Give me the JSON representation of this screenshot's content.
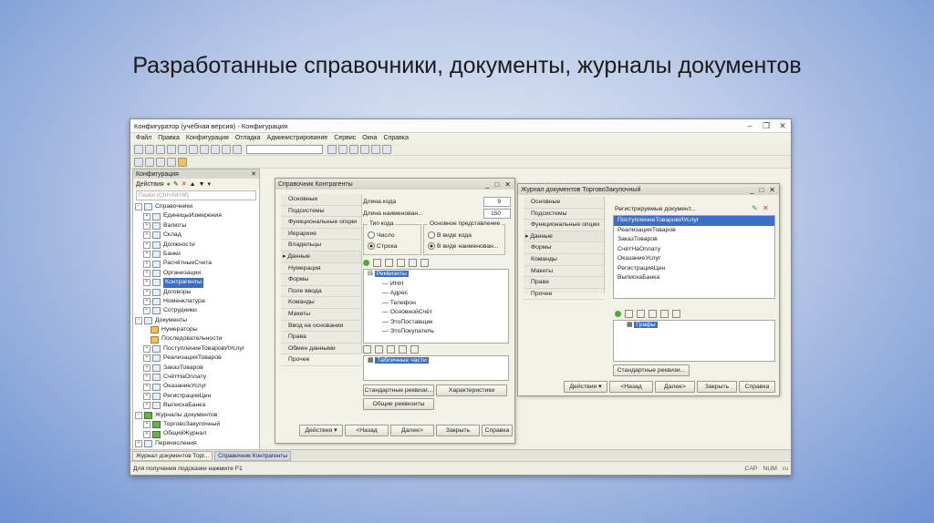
{
  "slide": {
    "title": "Разработанные справочники, документы, журналы документов"
  },
  "app": {
    "window_title": "Конфигуратор (учебная версия) - Конфигурация",
    "menu": [
      "Файл",
      "Правка",
      "Конфигурация",
      "Отладка",
      "Администрирование",
      "Сервис",
      "Окна",
      "Справка"
    ]
  },
  "config_panel": {
    "title": "Конфигурация",
    "actions_label": "Действия",
    "search_placeholder": "Поиск (Ctrl+Alt+M)",
    "tree": [
      {
        "label": "Справочники",
        "level": 0,
        "exp": "−",
        "icon": ""
      },
      {
        "label": "ЕдиницыИзмерения",
        "level": 1,
        "exp": "+",
        "icon": ""
      },
      {
        "label": "Валюты",
        "level": 1,
        "exp": "+",
        "icon": ""
      },
      {
        "label": "Склад",
        "level": 1,
        "exp": "+",
        "icon": ""
      },
      {
        "label": "Должности",
        "level": 1,
        "exp": "+",
        "icon": ""
      },
      {
        "label": "Банки",
        "level": 1,
        "exp": "+",
        "icon": ""
      },
      {
        "label": "РасчётныеСчета",
        "level": 1,
        "exp": "+",
        "icon": ""
      },
      {
        "label": "Организации",
        "level": 1,
        "exp": "+",
        "icon": ""
      },
      {
        "label": "Контрагенты",
        "level": 1,
        "exp": "+",
        "icon": "",
        "selected": true
      },
      {
        "label": "Договоры",
        "level": 1,
        "exp": "+",
        "icon": ""
      },
      {
        "label": "Номенклатура",
        "level": 1,
        "exp": "+",
        "icon": ""
      },
      {
        "label": "Сотрудники",
        "level": 1,
        "exp": "+",
        "icon": ""
      },
      {
        "label": "Документы",
        "level": 0,
        "exp": "−",
        "icon": ""
      },
      {
        "label": "Нумераторы",
        "level": 1,
        "exp": "",
        "icon": "o"
      },
      {
        "label": "Последовательности",
        "level": 1,
        "exp": "",
        "icon": "o"
      },
      {
        "label": "ПоступлениеТоваровИУслуг",
        "level": 1,
        "exp": "+",
        "icon": ""
      },
      {
        "label": "РеализацияТоваров",
        "level": 1,
        "exp": "+",
        "icon": ""
      },
      {
        "label": "ЗаказТоваров",
        "level": 1,
        "exp": "+",
        "icon": ""
      },
      {
        "label": "СчётНаОплату",
        "level": 1,
        "exp": "+",
        "icon": ""
      },
      {
        "label": "ОказаниеУслуг",
        "level": 1,
        "exp": "+",
        "icon": ""
      },
      {
        "label": "РегистрацияЦен",
        "level": 1,
        "exp": "+",
        "icon": ""
      },
      {
        "label": "ВыпискаБанка",
        "level": 1,
        "exp": "+",
        "icon": ""
      },
      {
        "label": "Журналы документов",
        "level": 0,
        "exp": "−",
        "icon": "g"
      },
      {
        "label": "ТорговоЗакупочный",
        "level": 1,
        "exp": "+",
        "icon": "g"
      },
      {
        "label": "ОбщийЖурнал",
        "level": 1,
        "exp": "+",
        "icon": "g"
      },
      {
        "label": "Перечисления",
        "level": 0,
        "exp": "+",
        "icon": ""
      }
    ]
  },
  "catalog_dialog": {
    "title": "Справочник Контрагенты",
    "nav": [
      "Основные",
      "Подсистемы",
      "Функциональные опции",
      "Иерархия",
      "Владельцы",
      "Данные",
      "Нумерация",
      "Формы",
      "Поле ввода",
      "Команды",
      "Макеты",
      "Ввод на основании",
      "Права",
      "Обмен данными",
      "Прочее"
    ],
    "code_length_label": "Длина кода",
    "code_length_value": "9",
    "name_length_label": "Длина наименован...",
    "name_length_value": "150",
    "code_type_group": "Тип кода",
    "code_type_options": [
      "Число",
      "Строка"
    ],
    "main_repr_group": "Основное представление",
    "main_repr_options": [
      "В виде кода",
      "В виде наименован..."
    ],
    "attributes_root": "Реквизиты",
    "attributes": [
      "ИНН",
      "Адрес",
      "Телефон",
      "ОсновнойСчёт",
      "ЭтоПоставщик",
      "ЭтоПокупатель"
    ],
    "tabular_parts": "Табличные части",
    "std_attrs_button": "Стандартные реквизи...",
    "characteristics_button": "Характеристики",
    "common_attrs_button": "Общие реквизиты",
    "footer": [
      "Действия",
      "<Назад",
      "Далее>",
      "Закрыть",
      "Справка"
    ]
  },
  "journal_dialog": {
    "title": "Журнал документов ТорговоЗакупочный",
    "nav": [
      "Основные",
      "Подсистемы",
      "Функциональные опции",
      "Данные",
      "Формы",
      "Команды",
      "Макеты",
      "Права",
      "Прочее"
    ],
    "registered_label": "Регистрируемые документ...",
    "documents": [
      "ПоступлениеТоваровИУслуг",
      "РеализацияТоваров",
      "ЗаказТоваров",
      "СчётНаОплату",
      "ОказаниеУслуг",
      "РегистрацияЦен",
      "ВыпискаБанка"
    ],
    "columns_root": "Графы",
    "std_attrs_button": "Стандартные реквизи...",
    "footer": [
      "Действия",
      "<Назад",
      "Далее>",
      "Закрыть",
      "Справка"
    ]
  },
  "taskbar": [
    "Журнал документов Торг...",
    "Справочник Контрагенты"
  ],
  "status": {
    "hint": "Для получения подсказки нажмите F1",
    "indicators": [
      "CAP",
      "NUM",
      "ru"
    ]
  },
  "colors": {
    "selection": "#3a6fc6",
    "dialog_bg": "#f3f1e6"
  }
}
